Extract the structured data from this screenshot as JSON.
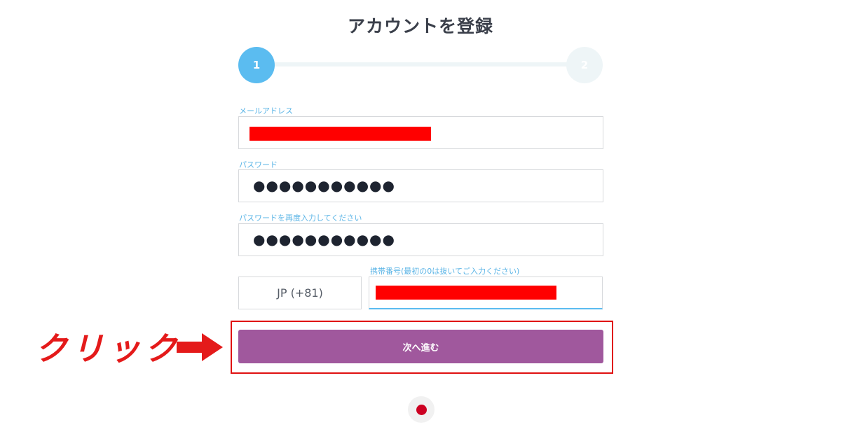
{
  "page": {
    "title": "アカウントを登録"
  },
  "stepper": {
    "step1": "1",
    "step2": "2"
  },
  "form": {
    "email_label": "メールアドレス",
    "password_label": "パスワード",
    "password_value": "●●●●●●●●●●●",
    "confirm_label": "パスワードを再度入力してください",
    "confirm_value": "●●●●●●●●●●●",
    "phone_label": "携帯番号(最初の0は抜いてご入力ください)",
    "country_code": "JP (+81)",
    "next_button": "次へ進む"
  },
  "annotation": {
    "click_text": "クリック"
  },
  "colors": {
    "accent": "#5bbcf0",
    "button": "#a0589d",
    "annotation": "#e41a1a",
    "redaction": "#ff0000"
  },
  "icons": {
    "language": "japan-flag-icon",
    "arrow": "right-arrow-icon"
  }
}
